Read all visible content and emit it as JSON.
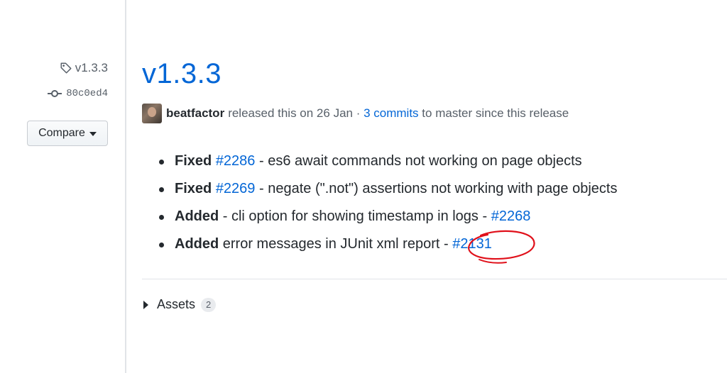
{
  "sidebar": {
    "tag_label": "v1.3.3",
    "commit_sha": "80c0ed4",
    "compare_label": "Compare"
  },
  "release": {
    "title": "v1.3.3",
    "author": "beatfactor",
    "released_text": "released this on 26 Jan ·",
    "commits_link": "3 commits",
    "commits_suffix": "to master since this release"
  },
  "notes": [
    {
      "type": "Fixed",
      "issue": "#2286",
      "text": " - es6 await commands not working on page objects"
    },
    {
      "type": "Fixed",
      "issue": "#2269",
      "text": " - negate (\".not\") assertions not working with page objects"
    },
    {
      "type": "Added",
      "text": " - cli option for showing timestamp in logs - ",
      "issue": "#2268"
    },
    {
      "type": "Added",
      "text": " error messages in JUnit xml report - ",
      "issue": "#2131"
    }
  ],
  "assets": {
    "label": "Assets",
    "count": "2"
  },
  "colors": {
    "link": "#0366d6",
    "annotation": "#e0101a"
  },
  "icons": [
    "tag-icon",
    "git-commit-icon",
    "caret-down-icon",
    "avatar",
    "triangle-right-icon"
  ]
}
